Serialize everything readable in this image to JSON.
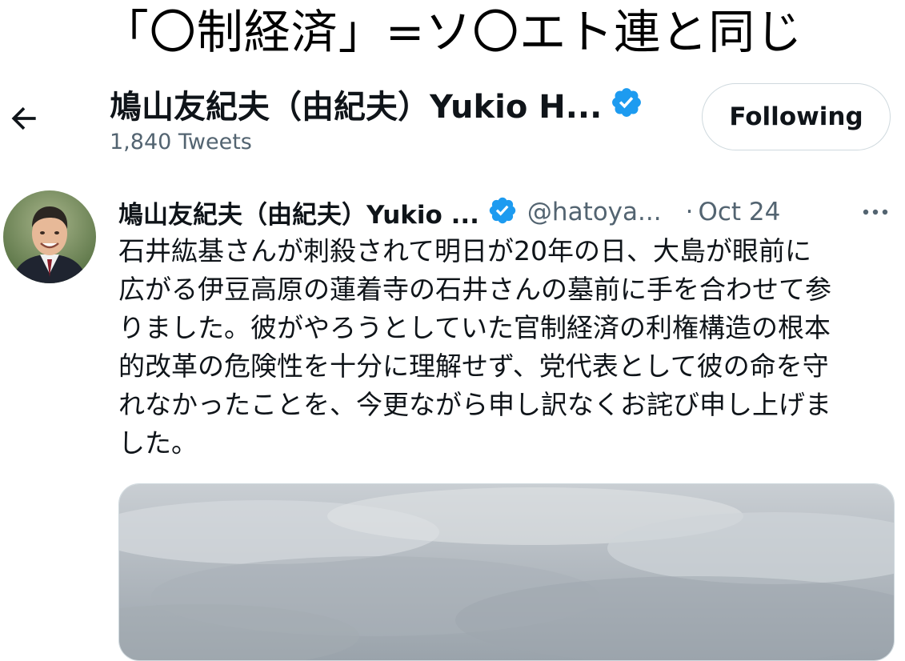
{
  "overlay": {
    "caption": "「〇制経済」=ソ〇エト連と同じ"
  },
  "header": {
    "back_icon": "arrow-left-icon",
    "name": "鳩山友紀夫（由紀夫）Yukio H...",
    "verified_icon": "verified-badge-icon",
    "tweet_count": "1,840 Tweets",
    "follow_button_label": "Following"
  },
  "tweet": {
    "avatar_icon": "profile-photo",
    "author_name": "鳩山友紀夫（由紀夫）Yukio ...",
    "verified_icon": "verified-badge-icon",
    "handle": "@hatoya...",
    "separator": "·",
    "date": "Oct 24",
    "more_icon": "more-horizontal-icon",
    "text": "石井紘基さんが刺殺されて明日が20年の日、大島が眼前に\n広がる伊豆高原の蓮着寺の石井さんの墓前に手を合わせて参\nりました。彼がやろうとしていた官制経済の利権構造の根本\n的改革の危険性を十分に理解せず、党代表として彼の命を守\nれなかったことを、今更ながら申し訳なくお詫び申し上げま\nした。",
    "media_icon": "sky-photo"
  },
  "colors": {
    "text_primary": "#0f1419",
    "text_secondary": "#536471",
    "verified_blue": "#1d9bf0",
    "border": "#cfd9de"
  }
}
